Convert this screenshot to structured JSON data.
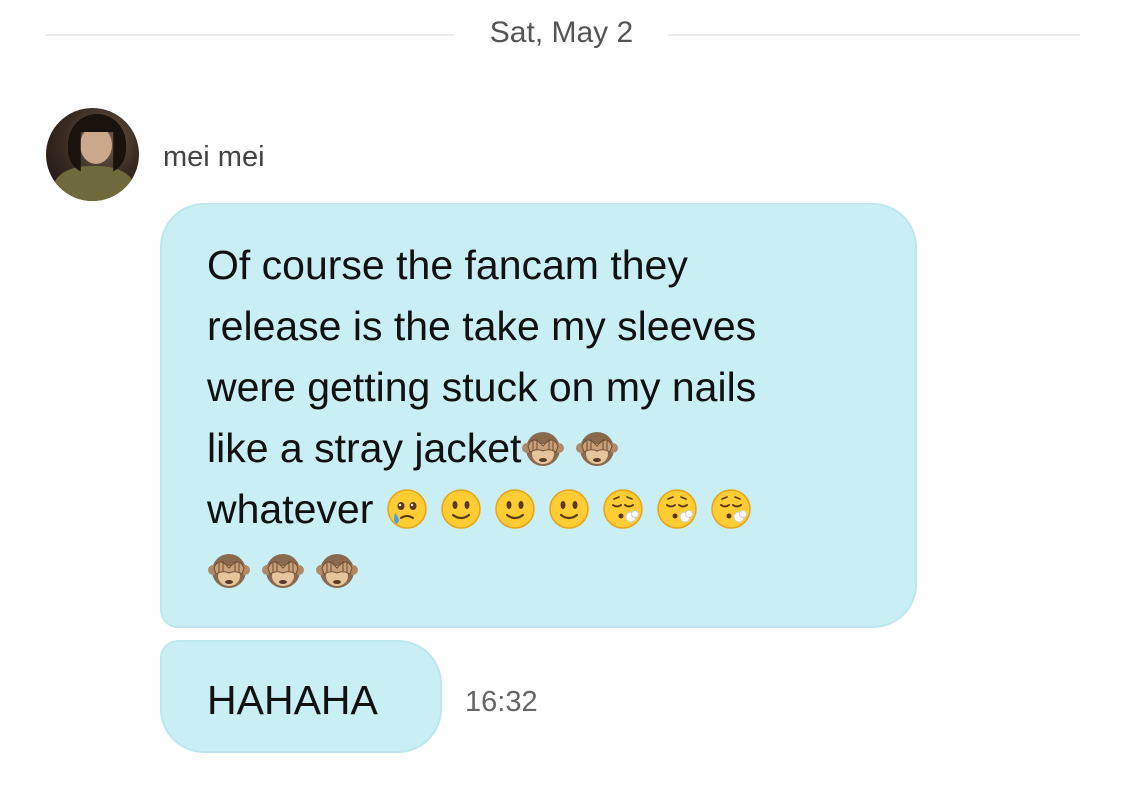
{
  "chat": {
    "date_separator": "Sat, May 2",
    "sender_name": "mei mei",
    "messages": [
      {
        "lines": [
          "Of course the fancam they",
          "release is the take my sleeves",
          "were getting stuck on my nails",
          "like a stray jacket",
          "whatever"
        ],
        "line4_emojis": [
          "see-no-evil-monkey-icon",
          "see-no-evil-monkey-icon"
        ],
        "line5_emojis": [
          "face-holding-back-tears-icon",
          "slightly-smiling-face-icon",
          "slightly-smiling-face-icon",
          "slightly-smiling-face-icon",
          "face-exhaling-icon",
          "face-exhaling-icon",
          "face-exhaling-icon"
        ],
        "line6_emojis": [
          "see-no-evil-monkey-icon",
          "see-no-evil-monkey-icon",
          "see-no-evil-monkey-icon"
        ]
      },
      {
        "text": "HAHAHA",
        "time": "16:32"
      }
    ]
  },
  "colors": {
    "bubble_background": "#c9eff4",
    "page_background": "#ffffff",
    "date_text": "#555555"
  }
}
